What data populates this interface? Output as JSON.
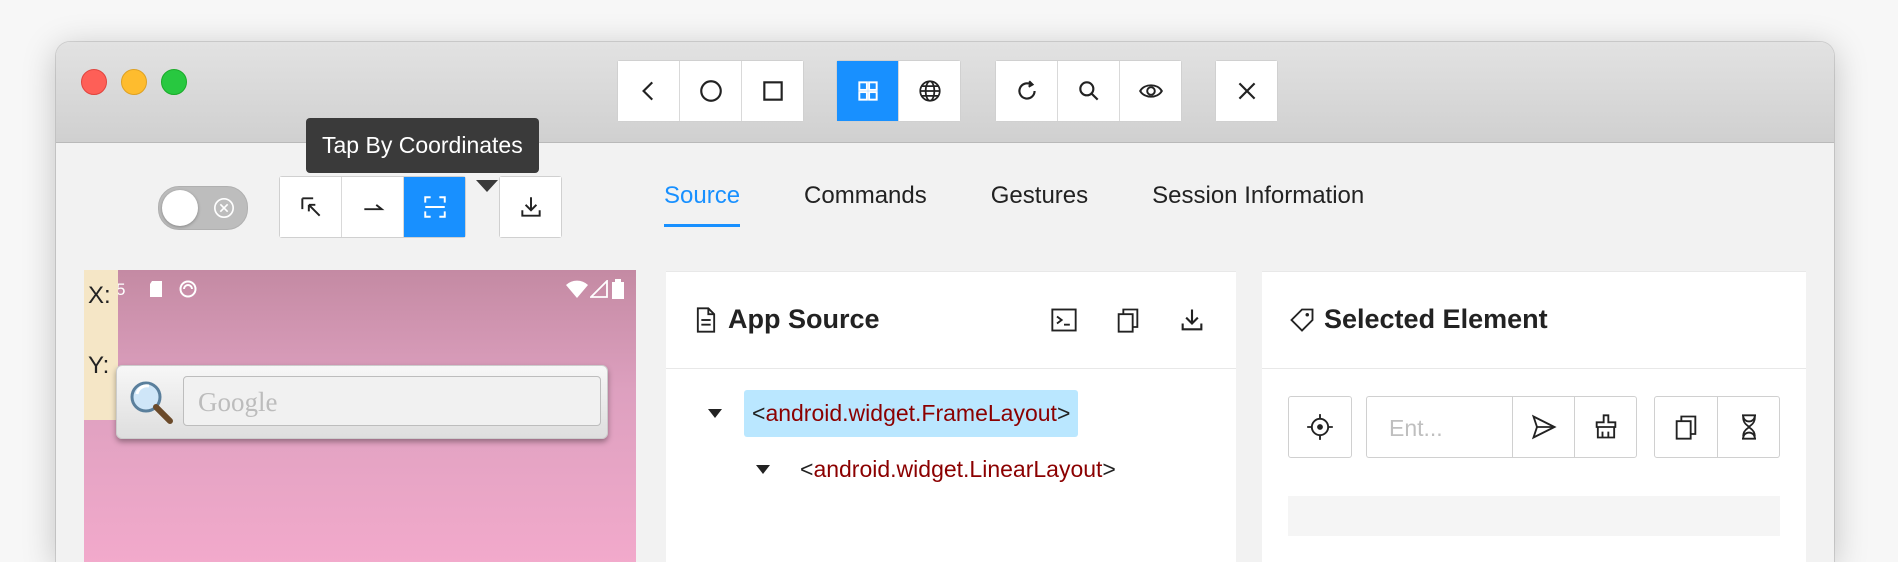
{
  "tooltip": {
    "text": "Tap By Coordinates"
  },
  "titlebar": {
    "nav_buttons": [
      "back-icon",
      "home-circle-icon",
      "square-icon"
    ],
    "mode_buttons": [
      "grid-icon",
      "globe-icon"
    ],
    "tool_buttons": [
      "refresh-icon",
      "search-icon",
      "eye-icon"
    ],
    "close_button": "close-icon"
  },
  "toolbar": {
    "toggle": {
      "state": "off",
      "icon": "close-circle-icon"
    },
    "mode_group": [
      "select-arrow-icon",
      "swipe-arrow-icon",
      "tap-coordinates-icon"
    ],
    "active_mode": "tap-coordinates-icon",
    "download": "download-icon"
  },
  "tabs": [
    {
      "label": "Source",
      "active": true
    },
    {
      "label": "Commands",
      "active": false
    },
    {
      "label": "Gestures",
      "active": false
    },
    {
      "label": "Session Information",
      "active": false
    }
  ],
  "device": {
    "status_time": "5",
    "coords": {
      "x_label": "X:",
      "y_label": "Y:"
    },
    "search_placeholder": "Google"
  },
  "app_source": {
    "title": "App Source",
    "tree": [
      {
        "open": "<",
        "name": "android.widget.FrameLayout",
        "close": ">",
        "selected": true
      },
      {
        "open": "<",
        "name": "android.widget.LinearLayout",
        "close": ">",
        "selected": false
      }
    ]
  },
  "selected_element": {
    "title": "Selected Element",
    "input_placeholder": "Ent..."
  },
  "colors": {
    "accent": "#1890ff",
    "selection": "#bae7ff",
    "tag_name": "#8b0000"
  }
}
